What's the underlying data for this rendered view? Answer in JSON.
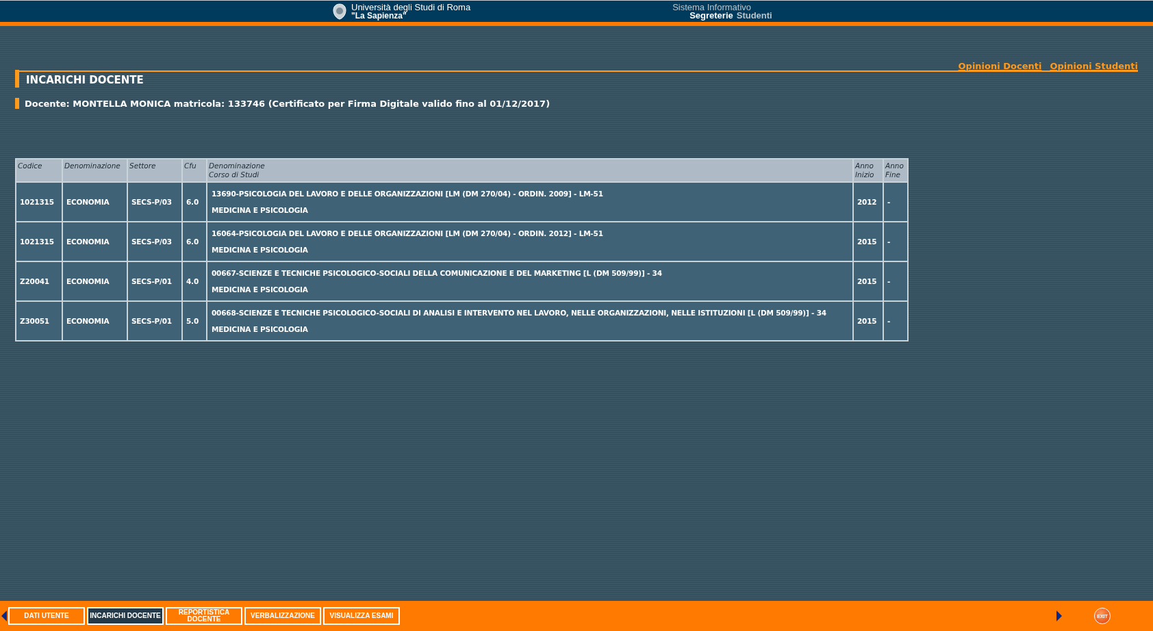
{
  "header": {
    "university_line1": "Università degli Studi di Roma",
    "university_line2": "\"La Sapienza\"",
    "system_line1": "Sistema Informativo",
    "system_word1": "Segreterie",
    "system_word2": "Studenti"
  },
  "top_links": [
    "Opinioni Docenti",
    "Opinioni Studenti"
  ],
  "page_title": "INCARICHI DOCENTE",
  "docente_info": "Docente: MONTELLA MONICA matricola: 133746 (Certificato per Firma Digitale valido fino al 01/12/2017)",
  "table": {
    "columns": [
      "Codice",
      "Denominazione",
      "Settore",
      "Cfu",
      "Denominazione\nCorso di Studi",
      "Anno\nInizio",
      "Anno\nFine"
    ],
    "rows": [
      {
        "codice": "1021315",
        "denominazione": "ECONOMIA",
        "settore": "SECS-P/03",
        "cfu": "6.0",
        "corso": "13690-PSICOLOGIA DEL LAVORO E DELLE ORGANIZZAZIONI [LM (DM 270/04) - ORDIN. 2009] - LM-51",
        "facolta": "MEDICINA E PSICOLOGIA",
        "anno_inizio": "2012",
        "anno_fine": "-"
      },
      {
        "codice": "1021315",
        "denominazione": "ECONOMIA",
        "settore": "SECS-P/03",
        "cfu": "6.0",
        "corso": "16064-PSICOLOGIA DEL LAVORO E DELLE ORGANIZZAZIONI [LM (DM 270/04) - ORDIN. 2012] - LM-51",
        "facolta": "MEDICINA E PSICOLOGIA",
        "anno_inizio": "2015",
        "anno_fine": "-"
      },
      {
        "codice": "Z20041",
        "denominazione": "ECONOMIA",
        "settore": "SECS-P/01",
        "cfu": "4.0",
        "corso": "00667-SCIENZE E TECNICHE PSICOLOGICO-SOCIALI DELLA COMUNICAZIONE E DEL MARKETING [L (DM 509/99)] - 34",
        "facolta": "MEDICINA E PSICOLOGIA",
        "anno_inizio": "2015",
        "anno_fine": "-"
      },
      {
        "codice": "Z30051",
        "denominazione": "ECONOMIA",
        "settore": "SECS-P/01",
        "cfu": "5.0",
        "corso": "00668-SCIENZE E TECNICHE PSICOLOGICO-SOCIALI DI ANALISI E INTERVENTO NEL LAVORO, NELLE ORGANIZZAZIONI, NELLE ISTITUZIONI [L (DM 509/99)] - 34",
        "facolta": "MEDICINA E PSICOLOGIA",
        "anno_inizio": "2015",
        "anno_fine": "-"
      }
    ]
  },
  "bottom_nav": [
    {
      "label": "DATI UTENTE",
      "selected": false
    },
    {
      "label": "INCARICHI DOCENTE",
      "selected": true
    },
    {
      "label": "REPORTISTICA\nDOCENTE",
      "selected": false
    },
    {
      "label": "VERBALIZZAZIONE",
      "selected": false
    },
    {
      "label": "VISUALIZZA ESAMI",
      "selected": false
    }
  ],
  "exit_button": "EXIT"
}
